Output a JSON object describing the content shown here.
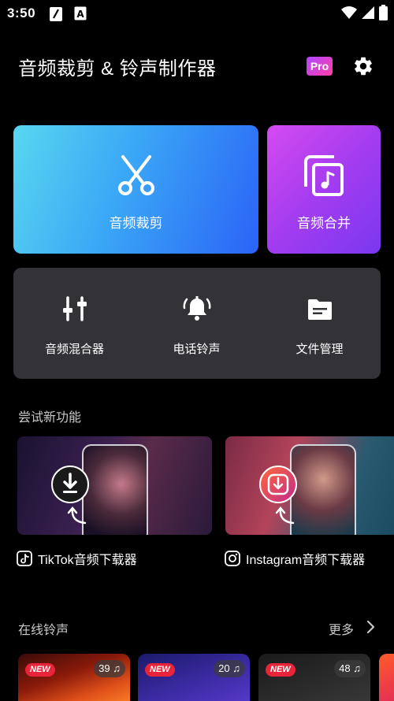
{
  "status_bar": {
    "time": "3:50"
  },
  "header": {
    "title": "音频裁剪 & 铃声制作器",
    "pro_label": "Pro"
  },
  "main_cards": {
    "trim_label": "音频裁剪",
    "merge_label": "音频合并"
  },
  "tools": [
    {
      "label": "音频混合器",
      "icon": "mixer-sliders-icon"
    },
    {
      "label": "电话铃声",
      "icon": "bell-ringing-icon"
    },
    {
      "label": "文件管理",
      "icon": "folder-icon"
    }
  ],
  "try_new": {
    "title": "尝试新功能",
    "items": [
      {
        "label": "TikTok音频下载器",
        "icon": "tiktok-icon"
      },
      {
        "label": "Instagram音频下载器",
        "icon": "instagram-icon"
      }
    ]
  },
  "online_ringtones": {
    "title": "在线铃声",
    "more_label": "更多",
    "items": [
      {
        "badge": "NEW",
        "count": "39"
      },
      {
        "badge": "NEW",
        "count": "20"
      },
      {
        "badge": "NEW",
        "count": "48"
      }
    ]
  },
  "colors": {
    "background": "#000000",
    "panel": "#333337",
    "pro_gradient_start": "#b046ff",
    "pro_gradient_end": "#ff3fa6",
    "new_badge": "#e8243a"
  }
}
